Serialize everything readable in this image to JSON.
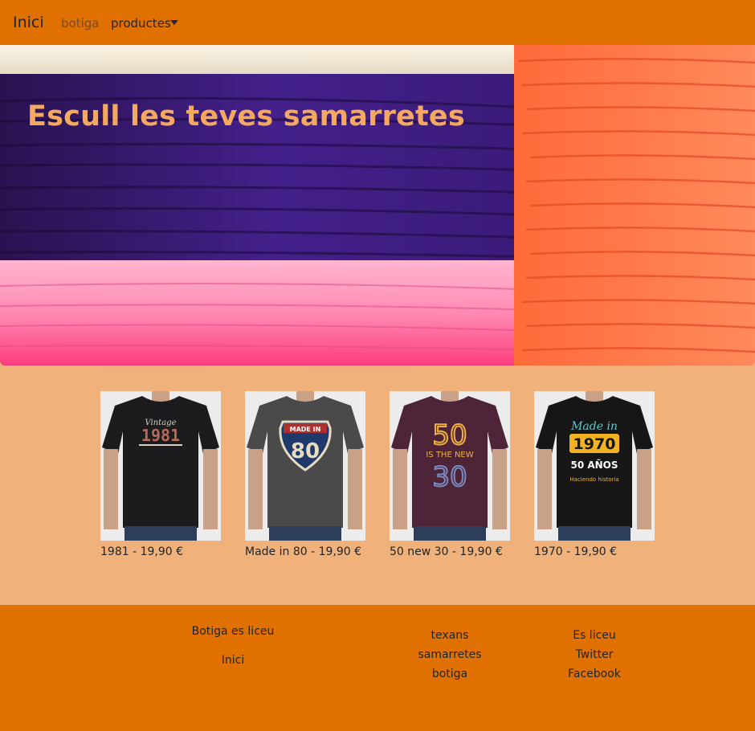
{
  "navbar": {
    "brand": "Inici",
    "links": [
      {
        "label": "botiga"
      },
      {
        "label": "productes"
      }
    ]
  },
  "hero": {
    "title": "Escull les teves samarretes"
  },
  "products": [
    {
      "caption": "1981 - 19,90 €",
      "shirt_color": "#1c1c1e",
      "print": "Vintage 1981"
    },
    {
      "caption": "Made in 80 - 19,90 €",
      "shirt_color": "#4a4a4a",
      "print": "MADE IN 80"
    },
    {
      "caption": "50 new 30 - 19,90 €",
      "shirt_color": "#4e2438",
      "print": "50 IS THE NEW 30"
    },
    {
      "caption": "1970 - 19,90 €",
      "shirt_color": "#161616",
      "print": "Made in 1970 50 AÑOS Haciendo historia"
    }
  ],
  "footer": {
    "col1": [
      "Botiga es liceu",
      "Inici"
    ],
    "col2": [
      "texans",
      "samarretes",
      "botiga"
    ],
    "col3": [
      "Es liceu",
      "Twitter",
      "Facebook"
    ]
  },
  "colors": {
    "navbar": "#e07000",
    "page_background": "#f0b27a",
    "hero_title": "#f5a860"
  }
}
